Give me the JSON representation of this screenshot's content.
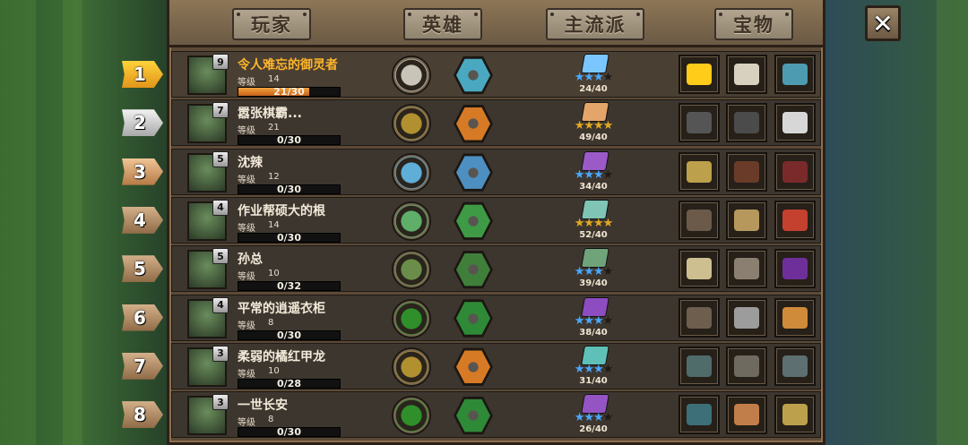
{
  "tabs": {
    "players": "玩家",
    "heroes": "英雄",
    "mainstream": "主流派",
    "treasures": "宝物"
  },
  "close_symbol": "✕",
  "level_label": "等级",
  "rows": [
    {
      "rank": "1",
      "rank_style": "gold",
      "name": "令人难忘的御灵者",
      "is_self": true,
      "avatar_level": "9",
      "level": "14",
      "xp": "21/30",
      "xp_fraction": 0.7,
      "hero_colors": [
        "#c9c4b8",
        "#4aa8c0"
      ],
      "book_color": "#7cc6ff",
      "stars_on": 3,
      "stars_total": 4,
      "star_color": "blue",
      "score": "24/40",
      "items": [
        "gear-icon",
        "compass-icon",
        "scroll-icon"
      ],
      "item_colors": [
        "#ffcc1a",
        "#d8d1c0",
        "#4d9bb0"
      ]
    },
    {
      "rank": "2",
      "rank_style": "silver",
      "name": "嚣张棋霸...",
      "is_self": false,
      "avatar_level": "7",
      "level": "21",
      "xp": "0/30",
      "xp_fraction": 0,
      "hero_colors": [
        "#b0902f",
        "#d77a25"
      ],
      "book_color": "#e4a56a",
      "stars_on": 4,
      "stars_total": 4,
      "star_color": "gold",
      "score": "49/40",
      "items": [
        "helmet-icon",
        "hat-icon",
        "medkit-icon"
      ],
      "item_colors": [
        "#555",
        "#4b4b4b",
        "#d7d7d7"
      ]
    },
    {
      "rank": "3",
      "rank_style": "bronze",
      "name": "沈辣",
      "is_self": false,
      "avatar_level": "5",
      "level": "12",
      "xp": "0/30",
      "xp_fraction": 0,
      "hero_colors": [
        "#5eaed8",
        "#4e8fc2"
      ],
      "book_color": "#9b5ac8",
      "stars_on": 3,
      "stars_total": 4,
      "star_color": "blue",
      "score": "34/40",
      "items": [
        "vip-card-icon",
        "bag-icon",
        "spellbook-icon"
      ],
      "item_colors": [
        "#bda04b",
        "#6b3b2a",
        "#7a2a2a"
      ]
    },
    {
      "rank": "4",
      "rank_style": "brown",
      "name": "作业帮硕大的根",
      "is_self": false,
      "avatar_level": "4",
      "level": "14",
      "xp": "0/30",
      "xp_fraction": 0,
      "hero_colors": [
        "#5fae6a",
        "#3e9a45"
      ],
      "book_color": "#7fc4b4",
      "stars_on": 4,
      "stars_total": 4,
      "star_color": "gold",
      "score": "52/40",
      "items": [
        "open-book-icon",
        "map-icon",
        "potion-icon"
      ],
      "item_colors": [
        "#6b5a4a",
        "#b7985c",
        "#c4412f"
      ]
    },
    {
      "rank": "5",
      "rank_style": "brown",
      "name": "孙总",
      "is_self": false,
      "avatar_level": "5",
      "level": "10",
      "xp": "0/32",
      "xp_fraction": 0,
      "hero_colors": [
        "#6a8e49",
        "#3f7f3a"
      ],
      "book_color": "#6fa37a",
      "stars_on": 3,
      "stars_total": 4,
      "star_color": "blue",
      "score": "39/40",
      "items": [
        "sword-icon",
        "spear-icon",
        "scythe-icon"
      ],
      "item_colors": [
        "#cdbf8f",
        "#8a7f70",
        "#6f2f9a"
      ]
    },
    {
      "rank": "6",
      "rank_style": "brown",
      "name": "平常的逍遥衣柜",
      "is_self": false,
      "avatar_level": "4",
      "level": "8",
      "xp": "0/30",
      "xp_fraction": 0,
      "hero_colors": [
        "#2f8f2a",
        "#2e8a36"
      ],
      "book_color": "#8d4cc0",
      "stars_on": 3,
      "stars_total": 4,
      "star_color": "blue",
      "score": "38/40",
      "items": [
        "chair-icon",
        "ring-icon",
        "ore-icon"
      ],
      "item_colors": [
        "#6d5e4e",
        "#9c9c9c",
        "#d08b3a"
      ]
    },
    {
      "rank": "7",
      "rank_style": "brown",
      "name": "柔弱的橘红甲龙",
      "is_self": false,
      "avatar_level": "3",
      "level": "10",
      "xp": "0/28",
      "xp_fraction": 0,
      "hero_colors": [
        "#b0902f",
        "#d77a25"
      ],
      "book_color": "#5fc0b8",
      "stars_on": 3,
      "stars_total": 4,
      "star_color": "blue",
      "score": "31/40",
      "items": [
        "anvil-icon",
        "staff-icon",
        "anvil-icon"
      ],
      "item_colors": [
        "#4f6b6a",
        "#6f6a60",
        "#5d6f70"
      ]
    },
    {
      "rank": "8",
      "rank_style": "brown",
      "name": "一世长安",
      "is_self": false,
      "avatar_level": "3",
      "level": "8",
      "xp": "0/30",
      "xp_fraction": 0,
      "hero_colors": [
        "#2f8f2a",
        "#2e8a36"
      ],
      "book_color": "#9454c4",
      "stars_on": 3,
      "stars_total": 4,
      "star_color": "blue",
      "score": "26/40",
      "items": [
        "tome-icon",
        "bracelet-icon",
        "vip-card-icon"
      ],
      "item_colors": [
        "#3d6f78",
        "#c27e4a",
        "#bda04b"
      ]
    }
  ]
}
